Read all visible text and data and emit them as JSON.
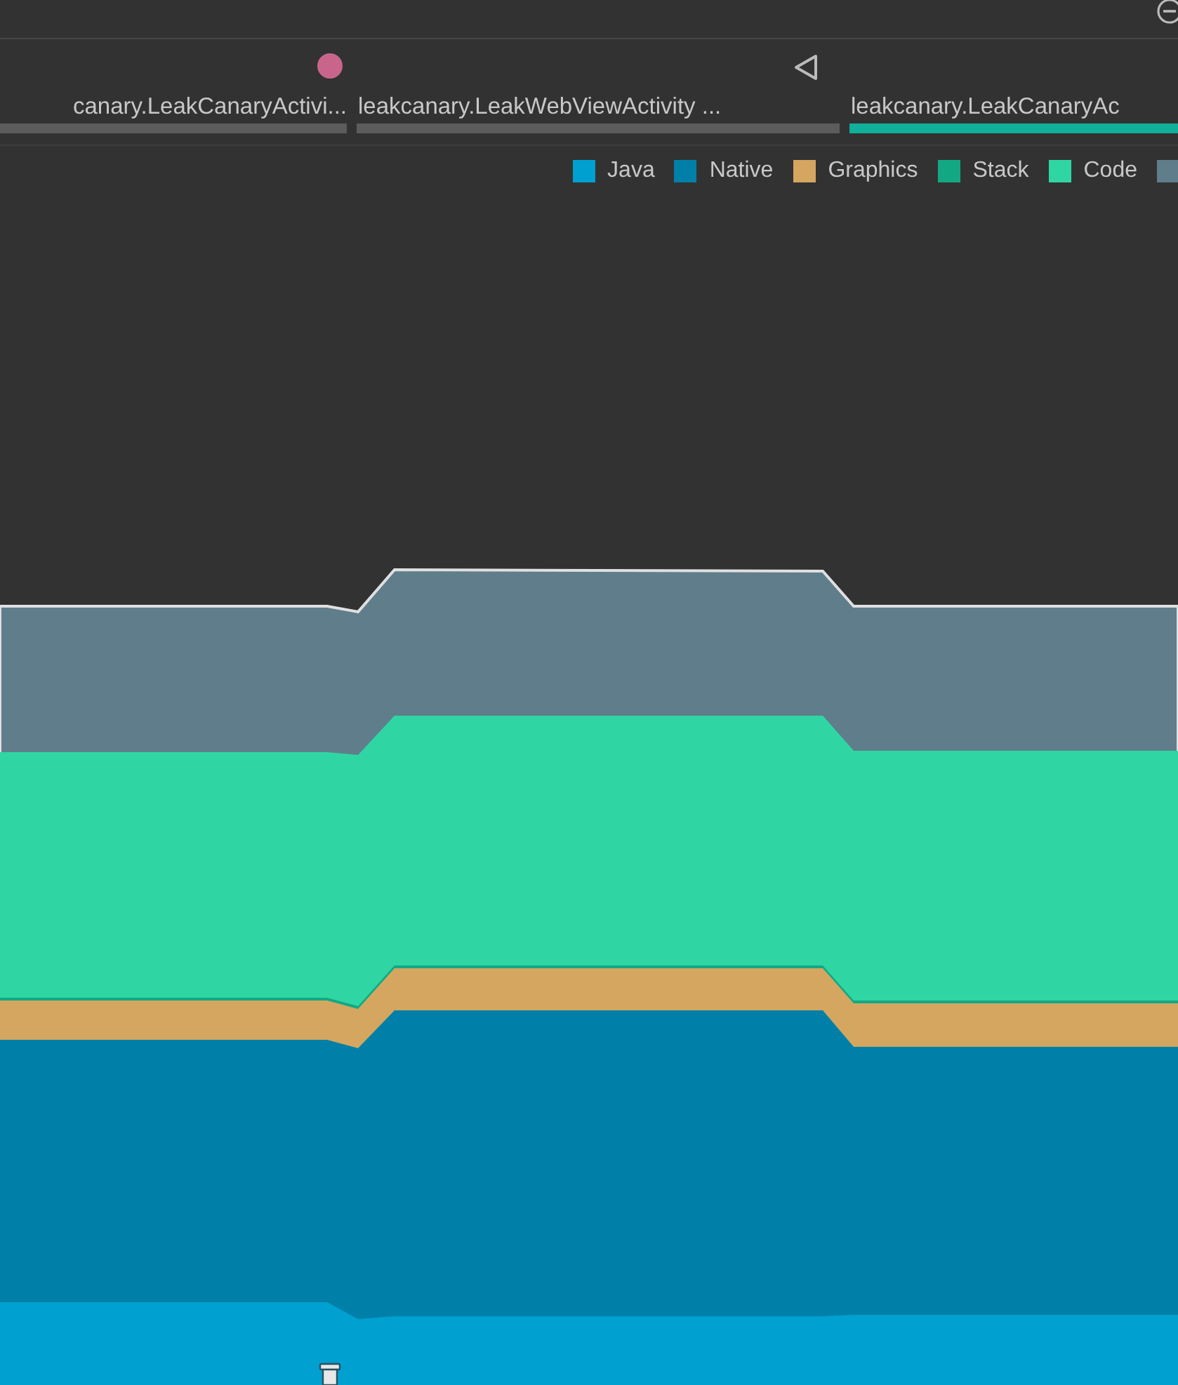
{
  "events": {
    "activities": [
      {
        "label": "canary.LeakCanaryActivi...",
        "selected": false
      },
      {
        "label": "leakcanary.LeakWebViewActivity ...",
        "selected": false
      },
      {
        "label": "leakcanary.LeakCanaryAc",
        "selected": true
      }
    ]
  },
  "legend": [
    {
      "label": "Java",
      "color": "#00a0d0"
    },
    {
      "label": "Native",
      "color": "#0080a8"
    },
    {
      "label": "Graphics",
      "color": "#d4a660"
    },
    {
      "label": "Stack",
      "color": "#13a884"
    },
    {
      "label": "Code",
      "color": "#2fd6a3"
    },
    {
      "color": "#607d8b"
    }
  ]
}
